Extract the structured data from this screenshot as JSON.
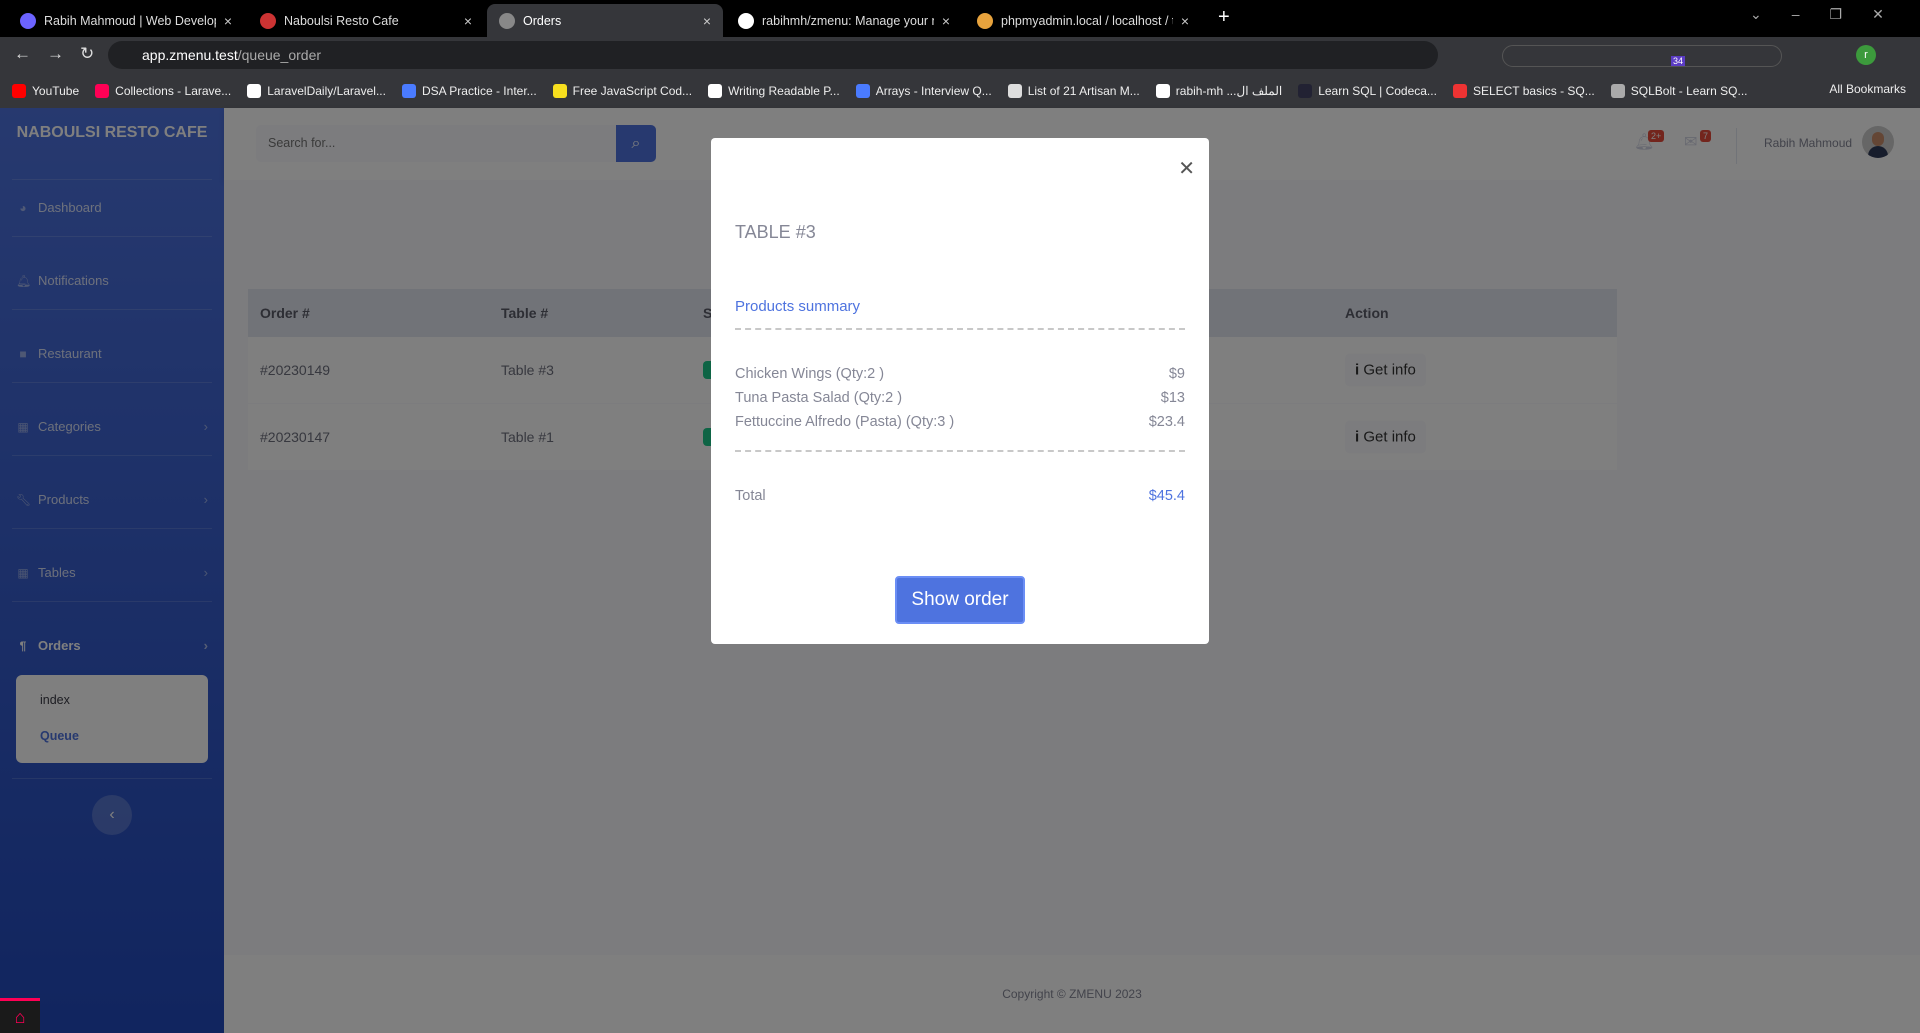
{
  "browser": {
    "tabs": [
      {
        "title": "Rabih Mahmoud | Web Develop",
        "active": false
      },
      {
        "title": "Naboulsi Resto Cafe",
        "active": false
      },
      {
        "title": "Orders",
        "active": true
      },
      {
        "title": "rabihmh/zmenu: Manage your n",
        "active": false
      },
      {
        "title": "phpmyadmin.local / localhost / t",
        "active": false
      }
    ],
    "url_host": "app.zmenu.test",
    "url_path": "/queue_order",
    "bookmarks": [
      "YouTube",
      "Collections - Larave...",
      "LaravelDaily/Laravel...",
      "DSA Practice - Inter...",
      "Free JavaScript Cod...",
      "Writing Readable P...",
      "Arrays - Interview Q...",
      "List of 21 Artisan M...",
      "rabih-mh ...الملف ال",
      "Learn SQL | Codeca...",
      "SELECT basics - SQ...",
      "SQLBolt - Learn SQ..."
    ],
    "all_bookmarks": "All Bookmarks",
    "extension_badge": "34",
    "profile_initial": "r"
  },
  "sidebar": {
    "brand": "NABOULSI RESTO CAFE",
    "items": [
      {
        "label": "Dashboard",
        "icon": "dashboard-icon"
      },
      {
        "label": "Notifications",
        "icon": "bell-icon"
      },
      {
        "label": "Restaurant",
        "icon": "bag-icon"
      },
      {
        "label": "Categories",
        "icon": "table-icon"
      },
      {
        "label": "Products",
        "icon": "wrench-icon"
      },
      {
        "label": "Tables",
        "icon": "table-icon"
      },
      {
        "label": "Orders",
        "icon": "utensils-icon"
      }
    ],
    "submenu": [
      "index",
      "Queue"
    ]
  },
  "topbar": {
    "search_placeholder": "Search for...",
    "alerts_badge": "2+",
    "messages_badge": "7",
    "user_name": "Rabih Mahmoud"
  },
  "table": {
    "headers": [
      "Order #",
      "Table #",
      "S",
      "Action"
    ],
    "rows": [
      {
        "order": "#20230149",
        "table": "Table #3",
        "action": "Get info"
      },
      {
        "order": "#20230147",
        "table": "Table #1",
        "action": "Get info"
      }
    ]
  },
  "modal": {
    "title": "TABLE #3",
    "summary_label": "Products summary",
    "products": [
      {
        "name": "Chicken Wings (Qty:2 )",
        "price": "$9"
      },
      {
        "name": "Tuna Pasta Salad (Qty:2 )",
        "price": "$13"
      },
      {
        "name": "Fettuccine Alfredo (Pasta) (Qty:3 )",
        "price": "$23.4"
      }
    ],
    "total_label": "Total",
    "total_value": "$45.4",
    "button": "Show order"
  },
  "footer": {
    "copyright": "Copyright © ZMENU 2023"
  },
  "colors": {
    "primary": "#4e73df",
    "success": "#1cc88a"
  }
}
